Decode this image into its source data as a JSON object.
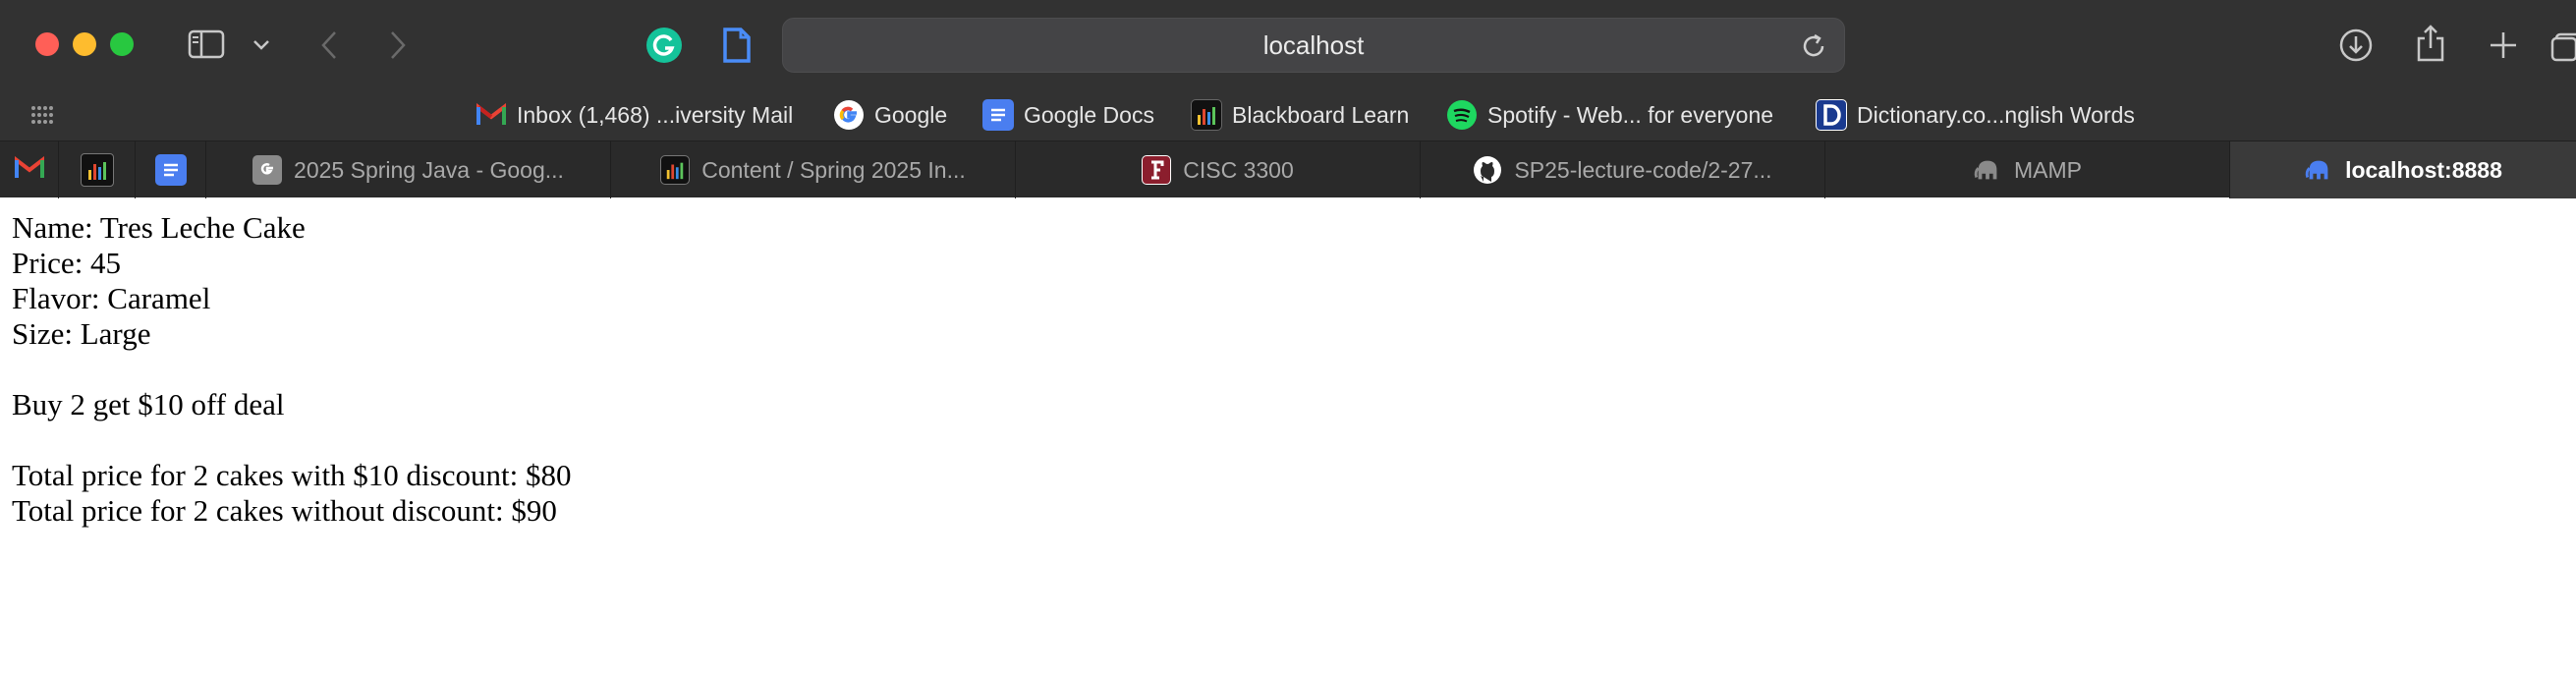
{
  "browser": {
    "address": "localhost"
  },
  "favorites": [
    {
      "label": "Inbox (1,468) ...iversity Mail",
      "icon": "gmail-icon"
    },
    {
      "label": "Google",
      "icon": "google-icon"
    },
    {
      "label": "Google Docs",
      "icon": "google-docs-icon"
    },
    {
      "label": "Blackboard Learn",
      "icon": "blackboard-icon"
    },
    {
      "label": "Spotify - Web... for everyone",
      "icon": "spotify-icon"
    },
    {
      "label": "Dictionary.co...nglish Words",
      "icon": "dictionary-icon"
    }
  ],
  "tabs": [
    {
      "label": "2025 Spring Java - Goog...",
      "icon": "google-g-icon"
    },
    {
      "label": "Content / Spring 2025 In...",
      "icon": "blackboard-icon"
    },
    {
      "label": "CISC 3300",
      "icon": "fordham-f-icon"
    },
    {
      "label": "SP25-lecture-code/2-27...",
      "icon": "github-icon"
    },
    {
      "label": "MAMP",
      "icon": "elephant-icon"
    },
    {
      "label": "localhost:8888",
      "icon": "elephant-icon",
      "active": true
    }
  ],
  "page": {
    "line1": "Name: Tres Leche Cake",
    "line2": "Price: 45",
    "line3": "Flavor: Caramel",
    "line4": "Size: Large",
    "line5": "Buy 2 get $10 off deal",
    "line6": "Total price for 2 cakes with $10 discount: $80",
    "line7": "Total price for 2 cakes without discount: $90"
  }
}
